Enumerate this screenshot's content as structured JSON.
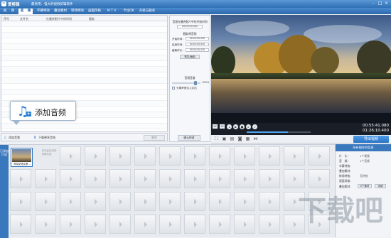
{
  "app": {
    "name": "爱剪辑",
    "slogan": "最易用、强大的视频剪辑软件",
    "window_controls": [
      "-",
      "□",
      "×"
    ]
  },
  "tabs": [
    "视",
    "频",
    "音",
    "频",
    "字幕特效",
    "叠加素材",
    "转场特效",
    "画面风格",
    "M T V",
    "卡拉OK",
    "升级与服务"
  ],
  "active_tab_index": 2,
  "list": {
    "columns": [
      "序号",
      "文件名",
      "在最终影片中的时间",
      "截取"
    ],
    "row_count": 20
  },
  "list_toolbar": {
    "add_audio": "添加音频",
    "download_more": "下载更多音效",
    "delete": "删除"
  },
  "callout": {
    "label": "添加音频"
  },
  "settings": {
    "header_top": "音频在最终影片中的开始时间",
    "start_time_value": "00:00:00.000",
    "section_title": "截取原音频",
    "start_label": "开始时间：",
    "end_label": "结束时间：",
    "duration_label": "截取时长：",
    "start_value": "00:00:00.000",
    "end_value": "00:00:00.000",
    "duration_value": "00:00:00.000",
    "preview_button": "预览/截取",
    "volume_title": "音频音量",
    "volume_value": "100%",
    "checkbox_label": "头尾声音淡入淡出",
    "confirm_button": "确认修改"
  },
  "player": {
    "time_current": "00:55:41.080",
    "time_total": "01:26:10.400",
    "speed_left": "1X",
    "speed_right": "1X",
    "progress_fraction": 0.64,
    "export_button": "导出视频"
  },
  "timeline": {
    "side_tab": "已添加片段",
    "clip_caption": "神探夏洛克第...",
    "ghost_line1": "双击此处添加",
    "ghost_line2": "视频片段"
  },
  "info_panel": {
    "title": "所有制作的信息",
    "rows": [
      {
        "k": "片　头：",
        "v": "1个视频"
      },
      {
        "k": "音　频：",
        "v": "1个音频"
      },
      {
        "k": "字幕特效：",
        "v": ""
      },
      {
        "k": "叠加素材：",
        "v": ""
      },
      {
        "k": "转场特效：",
        "v": "无特效"
      },
      {
        "k": "画面风格：",
        "v": ""
      }
    ],
    "count_label": "叠加素材：",
    "count_value": "0个素材",
    "detail_button": "详细"
  },
  "watermark": "下载吧"
}
